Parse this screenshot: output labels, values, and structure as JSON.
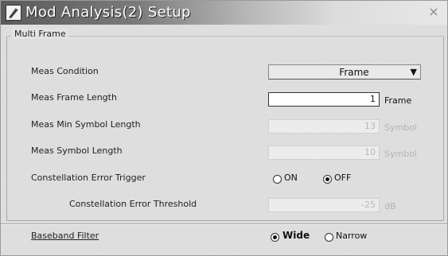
{
  "window": {
    "title": "Mod Analysis(2) Setup",
    "close_glyph": "×"
  },
  "multi_frame": {
    "group_title": "Multi Frame",
    "meas_condition": {
      "label": "Meas Condition",
      "value": "Frame"
    },
    "frame_length": {
      "label": "Meas Frame Length",
      "value": "1",
      "unit": "Frame",
      "enabled": true
    },
    "min_symbol_length": {
      "label": "Meas Min Symbol Length",
      "value": "13",
      "unit": "Symbol",
      "enabled": false
    },
    "symbol_length": {
      "label": "Meas Symbol Length",
      "value": "10",
      "unit": "Symbol",
      "enabled": false
    },
    "const_error_trigger": {
      "label": "Constellation Error Trigger",
      "options": [
        {
          "label": "ON",
          "checked": false
        },
        {
          "label": "OFF",
          "checked": true
        }
      ]
    },
    "const_error_threshold": {
      "label": "Constellation Error Threshold",
      "value": "-25",
      "unit": "dB",
      "enabled": false
    }
  },
  "baseband_filter": {
    "label": "Baseband Filter",
    "options": [
      {
        "label": "Wide",
        "checked": true
      },
      {
        "label": "Narrow",
        "checked": false
      }
    ]
  },
  "icons": {
    "app": "wrench-pencil-icon",
    "dropdown": "triangle-down-icon"
  },
  "colors": {
    "title_gradient_start": "#5a5a5a",
    "title_gradient_end": "#e8e8e8"
  }
}
